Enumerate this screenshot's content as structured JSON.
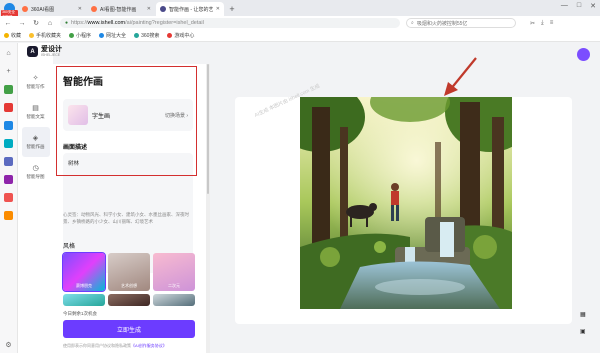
{
  "browser": {
    "badge": "360安全浏览器",
    "tabs": [
      {
        "label": "360AI看图",
        "active": false,
        "color": "#ff7043"
      },
      {
        "label": "AI看图-智能作画",
        "active": false,
        "color": "#ff7043"
      },
      {
        "label": "智能作画 - 让您的艺术创作更...",
        "active": true,
        "color": "#4a4a8a"
      }
    ],
    "nav": {
      "back": "←",
      "forward": "→",
      "reload": "↻",
      "home": "⌂"
    },
    "url": {
      "proto": "https://",
      "host": "www.ishell.com",
      "path": "/ai/painting?register=ishel_detail"
    },
    "search_placeholder": "吸烟和火药被控制55亿",
    "bookmarks": [
      "收藏",
      "手机收藏夹",
      "小程序",
      "网址大全",
      "360搜索",
      "游戏中心"
    ],
    "window_controls": {
      "min": "—",
      "max": "□",
      "close": "✕"
    }
  },
  "sidebar_icons": [
    "home-icon",
    "plus-icon",
    "app-icon",
    "app-icon",
    "app-icon",
    "app-icon",
    "app-icon",
    "app-icon",
    "app-icon",
    "app-icon"
  ],
  "app": {
    "brand_name": "爱设计",
    "brand_sub": "ISHELJECE",
    "nav": [
      {
        "icon": "✧",
        "label": "智能写作",
        "active": false
      },
      {
        "icon": "▤",
        "label": "智能文案",
        "active": false
      },
      {
        "icon": "◈",
        "label": "智能作画",
        "active": true
      },
      {
        "icon": "◷",
        "label": "智能导图",
        "active": false
      }
    ]
  },
  "panel": {
    "title": "智能作画",
    "model_name": "字生画",
    "model_switch": "切换场景 ›",
    "desc_label": "画面描述",
    "desc_value": "树林",
    "hint": "心灵签：动物风光、科学小女、建筑小女、水墨丝画家、深夜时景、乡镇桥路的小少女、山川丽晖、幻境艺术",
    "style_label": "风格",
    "styles": [
      "赛博朋克",
      "艺术创想",
      "二次元",
      "",
      "",
      ""
    ],
    "remain": "今日剩余1次机会",
    "generate_label": "立即生成",
    "agree_text": "使用即表示你同意用户协议和隐私政策",
    "agree_link": "《AI创作服务协议》"
  },
  "canvas": {
    "watermark": "AI生成 本图片由 ishell.com 生成"
  }
}
